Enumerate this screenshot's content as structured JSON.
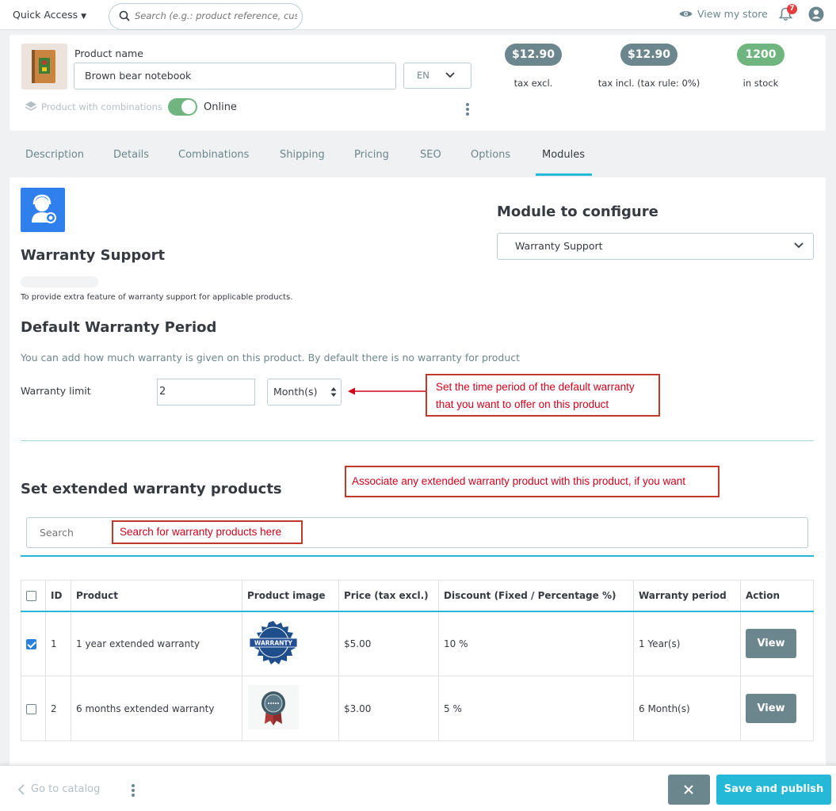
{
  "topbar": {
    "quick_access": "Quick Access",
    "search_placeholder": "Search (e.g.: product reference, custon",
    "view_store": "View my store",
    "notification_count": "7"
  },
  "product": {
    "name_label": "Product name",
    "name_value": "Brown bear notebook",
    "lang": "EN",
    "combinations_label": "Product with combinations",
    "status_label": "Online",
    "price_tax_excl": "$12.90",
    "price_tax_excl_label": "tax excl.",
    "price_tax_incl": "$12.90",
    "price_tax_incl_label": "tax incl. (tax rule: 0%)",
    "stock": "1200",
    "stock_label": "in stock"
  },
  "tabs": [
    "Description",
    "Details",
    "Combinations",
    "Shipping",
    "Pricing",
    "SEO",
    "Options",
    "Modules"
  ],
  "active_tab": "Modules",
  "module": {
    "title": "Warranty Support",
    "description": "To provide extra feature of warranty support for applicable products.",
    "configure_title": "Module to configure",
    "configure_value": "Warranty Support"
  },
  "default_warranty": {
    "title": "Default Warranty Period",
    "description": "You can add how much warranty is given on this product. By default there is no warranty for product",
    "limit_label": "Warranty limit",
    "limit_value": "2",
    "unit_value": "Month(s)"
  },
  "callouts": {
    "period_line1": "Set the time period of the default warranty",
    "period_line2": "that you want to offer on this product",
    "associate": "Associate any extended warranty product with this product, if you want",
    "search": "Search for warranty products here"
  },
  "extended": {
    "title": "Set extended warranty products",
    "search_placeholder": "Search",
    "columns": [
      "ID",
      "Product",
      "Product image",
      "Price (tax excl.)",
      "Discount (Fixed / Percentage %)",
      "Warranty period",
      "Action"
    ],
    "rows": [
      {
        "id": "1",
        "product": "1 year extended warranty",
        "image": "WARRANTY",
        "price": "$5.00",
        "discount": "10 %",
        "period": "1 Year(s)",
        "action": "View",
        "checked": true
      },
      {
        "id": "2",
        "product": "6 months extended warranty",
        "image": "",
        "price": "$3.00",
        "discount": "5 %",
        "period": "6 Month(s)",
        "action": "View",
        "checked": false
      }
    ]
  },
  "footer": {
    "go_to_catalog": "Go to catalog",
    "save_publish": "Save and publish"
  },
  "colors": {
    "accent": "#25b9d7",
    "price_pill": "#6c868e",
    "stock_pill": "#70b580",
    "annotation": "#d0021b"
  }
}
